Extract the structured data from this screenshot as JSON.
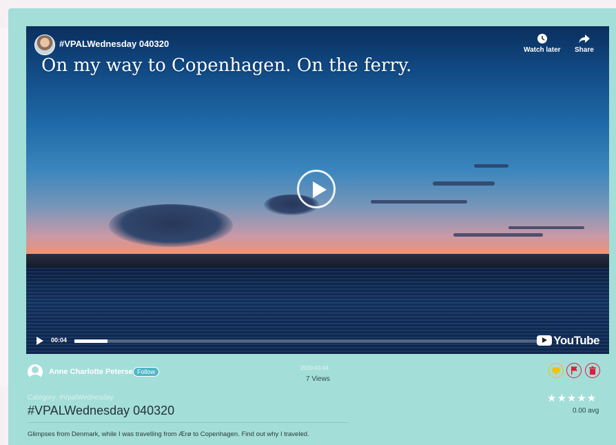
{
  "video": {
    "title": "#VPALWednesday 040320",
    "caption": "On my way to Copenhagen. On the ferry.",
    "watch_later_label": "Watch later",
    "share_label": "Share",
    "time": "00:04",
    "progress": 0.07,
    "brand": "YouTube"
  },
  "author": {
    "name": "Anne Charlotte Petersen",
    "follow_label": "Follow"
  },
  "meta": {
    "date": "2020-03-04",
    "views": "7 Views"
  },
  "actions": [
    {
      "name": "monitor-icon",
      "color": "#f2c200"
    },
    {
      "name": "flag-icon",
      "color": "#e5193a"
    },
    {
      "name": "trash-icon",
      "color": "#e5193a"
    }
  ],
  "category": "Category: #VpalWednesday",
  "rating": {
    "stars": "★★★★★",
    "avg": "0.00 avg"
  },
  "post_title": "#VPALWednesday 040320",
  "description": "Glimpses from Denmark, while I was travelling from Ærø to Copenhagen. Find out why I traveled."
}
